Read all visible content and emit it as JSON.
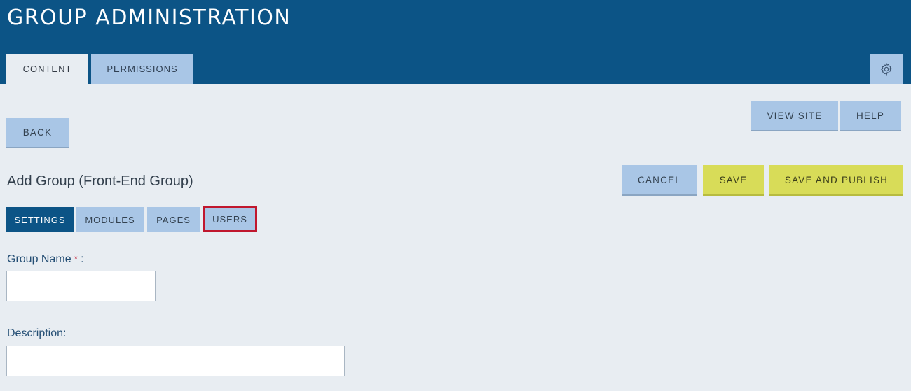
{
  "header": {
    "title": "GROUP ADMINISTRATION",
    "tabs": [
      {
        "label": "CONTENT",
        "active": true
      },
      {
        "label": "PERMISSIONS",
        "active": false
      }
    ],
    "settings_icon": "gear-icon"
  },
  "toolbar": {
    "back_label": "BACK",
    "view_site_label": "VIEW SITE",
    "help_label": "HELP"
  },
  "page": {
    "heading": "Add Group (Front-End Group)",
    "cancel_label": "CANCEL",
    "save_label": "SAVE",
    "save_publish_label": "SAVE AND PUBLISH"
  },
  "subtabs": [
    {
      "label": "SETTINGS",
      "active": true
    },
    {
      "label": "MODULES",
      "active": false
    },
    {
      "label": "PAGES",
      "active": false
    },
    {
      "label": "USERS",
      "active": false,
      "highlighted": true
    }
  ],
  "form": {
    "group_name_label": "Group Name",
    "required_marker": "*",
    "label_suffix": ":",
    "group_name_value": "",
    "description_label": "Description:",
    "description_value": ""
  },
  "colors": {
    "header_bg": "#0c5486",
    "page_bg": "#e8edf2",
    "button_blue": "#a9c6e6",
    "button_yellow": "#d8dc58",
    "highlight_red": "#c0172e"
  }
}
